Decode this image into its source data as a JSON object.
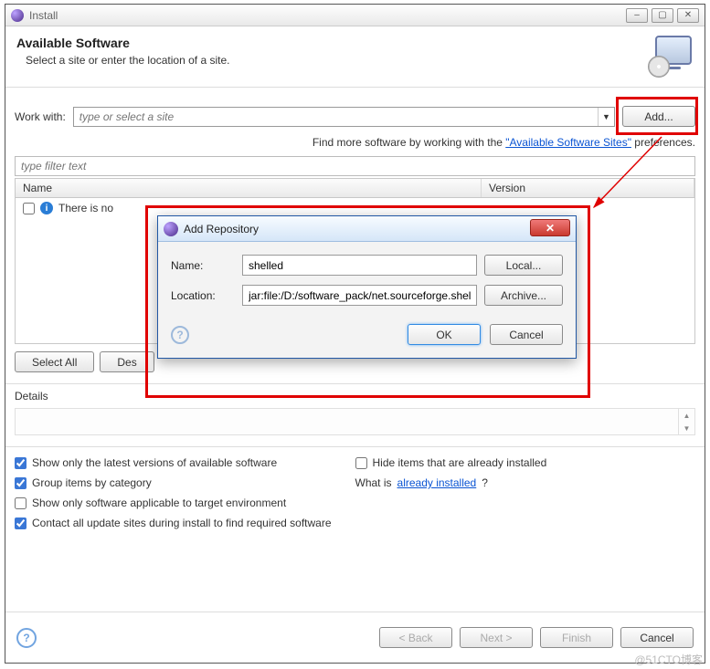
{
  "window": {
    "title": "Install",
    "banner_title": "Available Software",
    "banner_subtitle": "Select a site or enter the location of a site."
  },
  "work_with": {
    "label": "Work with:",
    "placeholder": "type or select a site",
    "add_button": "Add..."
  },
  "hint": {
    "prefix": "Find more software by working with the ",
    "link": "\"Available Software Sites\"",
    "suffix": " preferences."
  },
  "filter_placeholder": "type filter text",
  "columns": {
    "name": "Name",
    "version": "Version"
  },
  "empty_row": "There is no",
  "buttons": {
    "select_all": "Select All",
    "deselect_all": "Des",
    "back": "< Back",
    "next": "Next >",
    "finish": "Finish",
    "cancel": "Cancel"
  },
  "details_label": "Details",
  "options": {
    "latest_versions": {
      "label": "Show only the latest versions of available software",
      "checked": true
    },
    "hide_installed": {
      "label": "Hide items that are already installed",
      "checked": false
    },
    "group_by_category": {
      "label": "Group items by category",
      "checked": true
    },
    "what_is_prefix": "What is ",
    "what_is_link": "already installed",
    "show_applicable": {
      "label": "Show only software applicable to target environment",
      "checked": false
    },
    "contact_sites": {
      "label": "Contact all update sites during install to find required software",
      "checked": true
    }
  },
  "dialog": {
    "title": "Add Repository",
    "name_label": "Name:",
    "name_value": "shelled",
    "location_label": "Location:",
    "location_value": "jar:file:/D:/software_pack/net.sourceforge.shelled-sit",
    "local_button": "Local...",
    "archive_button": "Archive...",
    "ok": "OK",
    "cancel": "Cancel"
  },
  "watermark": "@51CTO博客"
}
